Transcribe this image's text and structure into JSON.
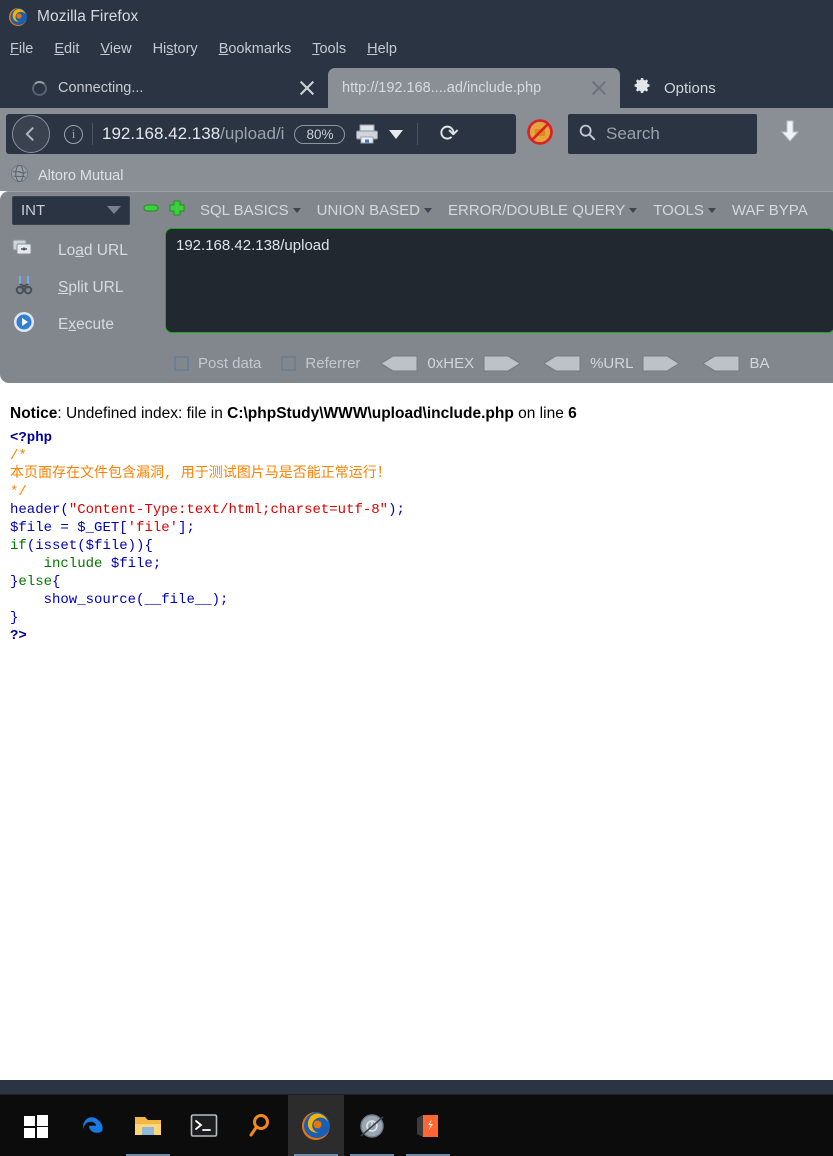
{
  "window": {
    "title": "Mozilla Firefox",
    "app_icon": "firefox-logo-icon"
  },
  "menubar": {
    "items": [
      {
        "label": "File",
        "accel": "F"
      },
      {
        "label": "Edit",
        "accel": "E"
      },
      {
        "label": "View",
        "accel": "V"
      },
      {
        "label": "History",
        "accel": "s"
      },
      {
        "label": "Bookmarks",
        "accel": "B"
      },
      {
        "label": "Tools",
        "accel": "T"
      },
      {
        "label": "Help",
        "accel": "H"
      }
    ]
  },
  "tabs": {
    "items": [
      {
        "label": "Connecting...",
        "state": "loading",
        "active": false
      },
      {
        "label": "http://192.168....ad/include.php",
        "state": "loaded",
        "active": true
      }
    ],
    "options_button": "Options",
    "close_icon": "close-icon",
    "gear_icon": "gear-icon"
  },
  "navbar": {
    "back_icon": "back-arrow-icon",
    "identity_icon": "info-circle-icon",
    "url_prefix": "192.168.42.138",
    "url_suffix": "/upload/i",
    "zoom_level": "80%",
    "printer_icon": "printer-icon",
    "dropdown_icon": "chevron-down-icon",
    "reload_icon": "reload-icon",
    "noscript_icon": "noscript-blocked-icon",
    "search_icon": "search-icon",
    "search_placeholder": "Search",
    "download_icon": "download-arrow-icon"
  },
  "bookmarks": {
    "items": [
      {
        "label": "Altoro Mutual",
        "icon": "globe-icon"
      }
    ]
  },
  "hackbar": {
    "select_value": "INT",
    "select_caret_icon": "chevron-down-icon",
    "minus_icon": "minus-button-icon",
    "plus_icon": "plus-button-icon",
    "menu": [
      {
        "label": "SQL BASICS"
      },
      {
        "label": "UNION BASED"
      },
      {
        "label": "ERROR/DOUBLE QUERY"
      },
      {
        "label": "TOOLS"
      },
      {
        "label": "WAF BYPA"
      }
    ],
    "actions": [
      {
        "label_pre": "Lo",
        "label_accel": "a",
        "label_post": "d URL",
        "icon": "load-url-icon"
      },
      {
        "label_pre": "",
        "label_accel": "S",
        "label_post": "plit URL",
        "icon": "split-url-icon"
      },
      {
        "label_pre": "E",
        "label_accel": "x",
        "label_post": "ecute",
        "icon": "execute-icon"
      }
    ],
    "textarea_value": "192.168.42.138/upload",
    "checkboxes": [
      {
        "label": "Post data",
        "checked": false
      },
      {
        "label": "Referrer",
        "checked": false
      }
    ],
    "encoders": [
      {
        "label": "0xHEX"
      },
      {
        "label": "%URL"
      },
      {
        "label": "BA"
      }
    ]
  },
  "page": {
    "notice": {
      "prefix_bold": "Notice",
      "middle": ": Undefined index: file in ",
      "path_bold": "C:\\phpStudy\\WWW\\upload\\include.php",
      "suffix": " on line ",
      "line_bold": "6"
    },
    "code_lines": [
      {
        "segments": [
          {
            "t": "<?php",
            "c": "c-tag"
          }
        ]
      },
      {
        "segments": [
          {
            "t": "/*",
            "c": "c-com"
          }
        ]
      },
      {
        "segments": [
          {
            "t": "本页面存在文件包含漏洞, 用于测试图片马是否能正常运行！",
            "c": "c-com"
          }
        ]
      },
      {
        "segments": [
          {
            "t": "*/",
            "c": "c-com"
          }
        ]
      },
      {
        "segments": [
          {
            "t": "header",
            "c": "c-kw"
          },
          {
            "t": "(",
            "c": "c-plain"
          },
          {
            "t": "\"Content-Type:text/html;charset=utf-8\"",
            "c": "c-str"
          },
          {
            "t": ");",
            "c": "c-plain"
          }
        ]
      },
      {
        "segments": [
          {
            "t": "$file ",
            "c": "c-kw"
          },
          {
            "t": "= ",
            "c": "c-plain"
          },
          {
            "t": "$_GET",
            "c": "c-kw"
          },
          {
            "t": "[",
            "c": "c-plain"
          },
          {
            "t": "'file'",
            "c": "c-str"
          },
          {
            "t": "];",
            "c": "c-plain"
          }
        ]
      },
      {
        "segments": [
          {
            "t": "if",
            "c": "c-def"
          },
          {
            "t": "(",
            "c": "c-plain"
          },
          {
            "t": "isset",
            "c": "c-kw"
          },
          {
            "t": "(",
            "c": "c-plain"
          },
          {
            "t": "$file",
            "c": "c-kw"
          },
          {
            "t": ")){",
            "c": "c-plain"
          }
        ]
      },
      {
        "segments": [
          {
            "t": "    include ",
            "c": "c-def"
          },
          {
            "t": "$file",
            "c": "c-kw"
          },
          {
            "t": ";",
            "c": "c-plain"
          }
        ]
      },
      {
        "segments": [
          {
            "t": "}",
            "c": "c-plain"
          },
          {
            "t": "else",
            "c": "c-def"
          },
          {
            "t": "{",
            "c": "c-plain"
          }
        ]
      },
      {
        "segments": [
          {
            "t": "    show_source",
            "c": "c-kw"
          },
          {
            "t": "(",
            "c": "c-plain"
          },
          {
            "t": "__file__",
            "c": "c-kw"
          },
          {
            "t": ");",
            "c": "c-plain"
          }
        ]
      },
      {
        "segments": [
          {
            "t": "}",
            "c": "c-plain"
          }
        ]
      },
      {
        "segments": [
          {
            "t": "?>",
            "c": "c-tag"
          }
        ]
      }
    ]
  },
  "taskbar": {
    "items": [
      {
        "icon": "windows-start-icon",
        "active": false,
        "running": false
      },
      {
        "icon": "edge-browser-icon",
        "active": false,
        "running": false
      },
      {
        "icon": "file-explorer-icon",
        "active": false,
        "running": true
      },
      {
        "icon": "terminal-icon",
        "active": false,
        "running": false
      },
      {
        "icon": "search-magnifier-icon",
        "active": false,
        "running": false
      },
      {
        "icon": "firefox-browser-icon",
        "active": true,
        "running": true
      },
      {
        "icon": "disc-tool-icon",
        "active": false,
        "running": true
      },
      {
        "icon": "burpsuite-icon",
        "active": false,
        "running": true
      }
    ]
  },
  "colors": {
    "chrome_dark": "#2b3442",
    "chrome_gray": "#8a8f96",
    "accent_green": "#1ea81e",
    "comment_orange": "#FF8000",
    "keyword_blue": "#0000BB",
    "string_red": "#DD0000",
    "default_green": "#007700",
    "taskbar_black": "#0c0c0c"
  }
}
